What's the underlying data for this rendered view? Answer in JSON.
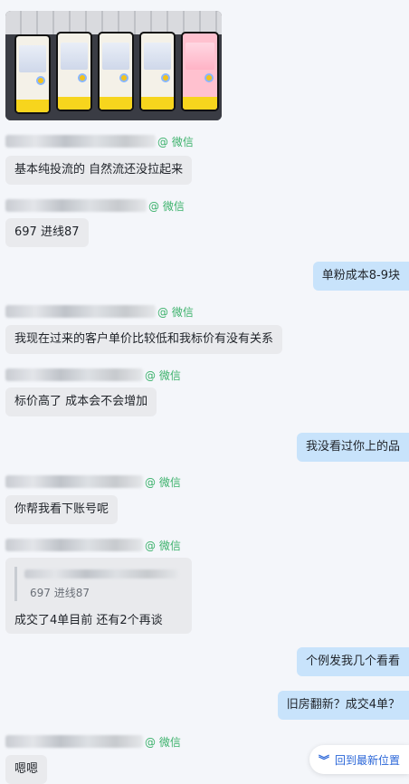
{
  "source_label": "@ 微信",
  "messages": [
    {
      "text": "基本纯投流的 自然流还没拉起来"
    },
    {
      "text": "697  进线87"
    },
    {
      "text": "单粉成本8-9块"
    },
    {
      "text": "我现在过来的客户单价比较低和我标价有没有关系"
    },
    {
      "text": "标价高了 成本会不会增加"
    },
    {
      "text": "我没看过你上的品"
    },
    {
      "text": "你帮我看下账号呢"
    },
    {
      "quote": "697  进线87",
      "text": "成交了4单目前 还有2个再谈"
    },
    {
      "text": "个例发我几个看看"
    },
    {
      "text": "旧房翻新？成交4单？"
    },
    {
      "text": "嗯嗯"
    }
  ],
  "jump_button": {
    "label": "回到最新位置",
    "icon": "double-chevron-down-icon"
  },
  "colors": {
    "left_bubble": "#e9eaed",
    "right_bubble": "#c8e3fb",
    "source": "#3bb16b",
    "link": "#2a66d8"
  }
}
